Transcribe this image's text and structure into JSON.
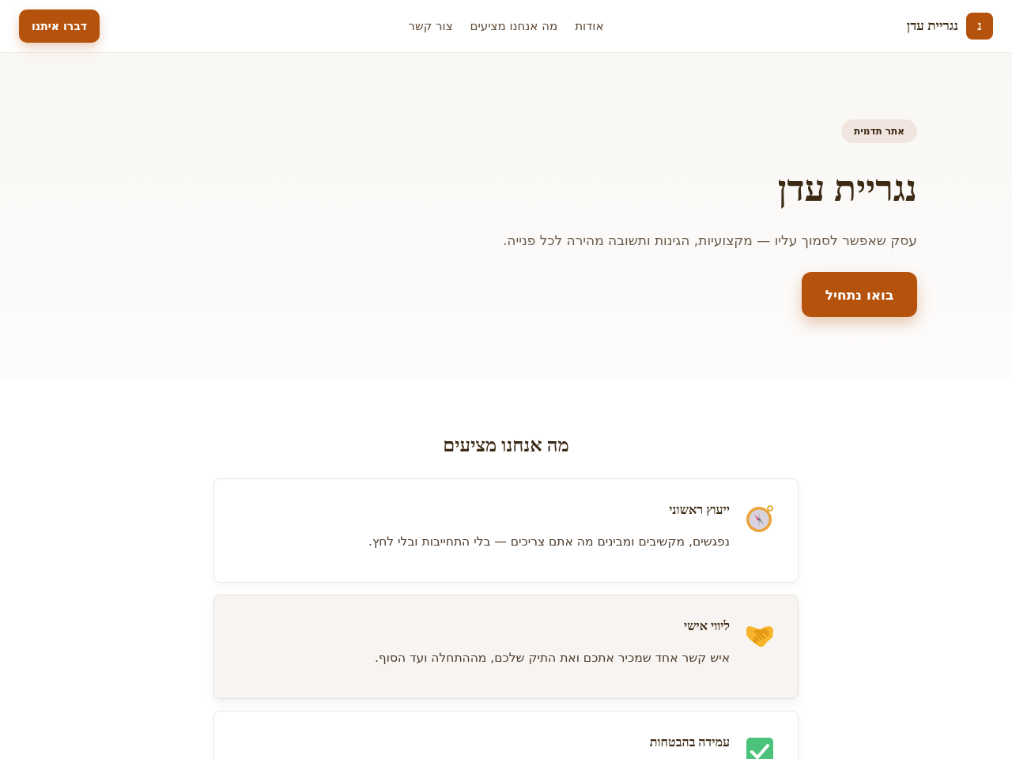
{
  "header": {
    "logo_letter": "נ",
    "brand": "נגריית עדן",
    "nav": [
      {
        "label": "אודות"
      },
      {
        "label": "מה אנחנו מציעים"
      },
      {
        "label": "צור קשר"
      }
    ],
    "cta": "דברו איתנו"
  },
  "hero": {
    "badge": "אתר תדמית",
    "title": "נגריית עדן",
    "subtitle": "עסק שאפשר לסמוך עליו — מקצועיות, הגינות ותשובה מהירה לכל פנייה.",
    "button": "בואו נתחיל"
  },
  "services": {
    "heading": "מה אנחנו מציעים",
    "cards": [
      {
        "title": "ייעוץ ראשוני",
        "description": "נפגשים, מקשיבים ומבינים מה אתם צריכים — בלי התחייבות ובלי לחץ.",
        "highlighted": false
      },
      {
        "title": "ליווי אישי",
        "description": "איש קשר אחד שמכיר אתכם ואת התיק שלכם, מההתחלה ועד הסוף.",
        "highlighted": true
      },
      {
        "title": "עמידה בהבטחות",
        "highlighted": false
      }
    ]
  }
}
